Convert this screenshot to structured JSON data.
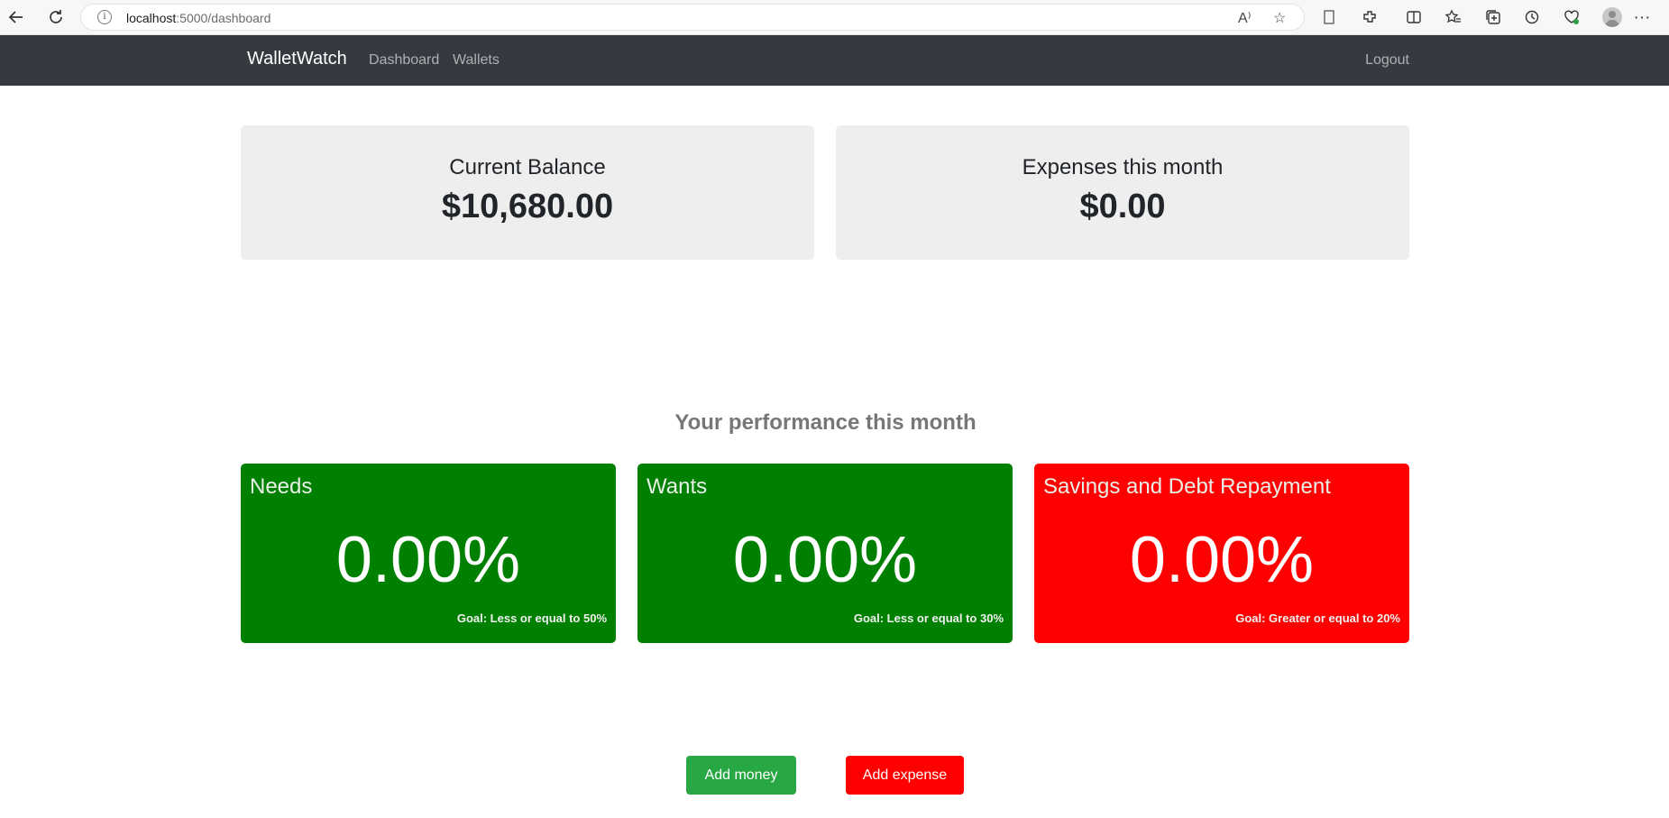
{
  "browser": {
    "url_host": "localhost",
    "url_path": ":5000/dashboard",
    "read_aloud": "A⁾"
  },
  "nav": {
    "brand": "WalletWatch",
    "links": [
      "Dashboard",
      "Wallets"
    ],
    "logout": "Logout"
  },
  "summary": {
    "balance_label": "Current Balance",
    "balance_value": "$10,680.00",
    "expenses_label": "Expenses this month",
    "expenses_value": "$0.00"
  },
  "performance": {
    "title": "Your performance this month",
    "cards": [
      {
        "name": "Needs",
        "value": "0.00%",
        "goal": "Goal: Less or equal to 50%",
        "color": "#008000"
      },
      {
        "name": "Wants",
        "value": "0.00%",
        "goal": "Goal: Less or equal to 30%",
        "color": "#008000"
      },
      {
        "name": "Savings and Debt Repayment",
        "value": "0.00%",
        "goal": "Goal: Greater or equal to 20%",
        "color": "#ff0000"
      }
    ]
  },
  "actions": {
    "add_money": "Add money",
    "add_expense": "Add expense",
    "add_money_color": "#28a745",
    "add_expense_color": "#ff0000"
  }
}
